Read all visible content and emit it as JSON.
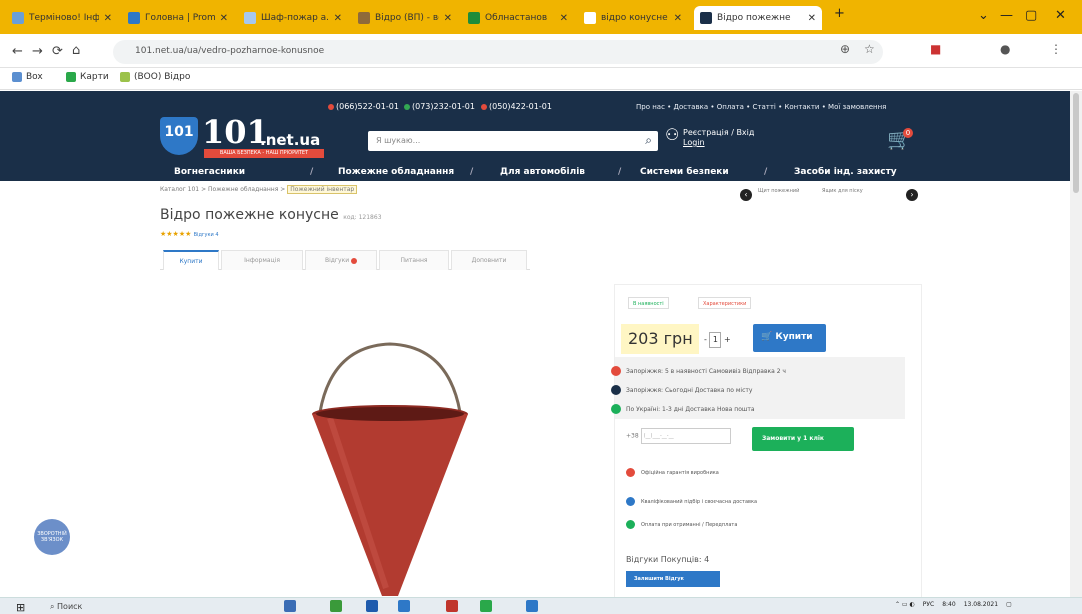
{
  "browser": {
    "tabs": [
      {
        "title": "Терміново! Інф",
        "color": "#6a9fd8"
      },
      {
        "title": "Головна | Prom",
        "color": "#2e78c7"
      },
      {
        "title": "Шаф-пожар а.р.",
        "color": "#a6c8ef"
      },
      {
        "title": "Відро (ВП) - всі",
        "color": "#8f6a3a"
      },
      {
        "title": "Облнастанов",
        "color": "#1f8c3a"
      },
      {
        "title": "відро конусне",
        "color": "#ffffff"
      },
      {
        "title": "Відро пожежне",
        "color": "#1a2f48",
        "active": true
      }
    ],
    "url": "101.net.ua/ua/vedro-pozharnoe-konusnoe",
    "bookmarks": [
      "Box",
      "Карти",
      "(ВОО) Відро"
    ]
  },
  "site": {
    "phones": [
      {
        "number": "(066)522-01-01",
        "color": "#e34b3c"
      },
      {
        "number": "(073)232-01-01",
        "color": "#33a853"
      },
      {
        "number": "(050)422-01-01",
        "color": "#e34b3c"
      }
    ],
    "top_links": "Про нас  •  Доставка  •  Оплата  •  Статті  •  Контакти  •  Мої замовлення",
    "logo": {
      "mark": "101",
      "number": "101",
      "domain": ".net.ua",
      "tagline": "ВАША БЕЗПЕКА - НАШ ПРІОРИТЕТ"
    },
    "search_placeholder": "Я шукаю...",
    "login": {
      "line1": "Реєстрація / Вхід",
      "line2": "Login"
    },
    "cart_count": "0",
    "nav": [
      "Вогнегасники",
      "Пожежне обладнання",
      "Для автомобілів",
      "Системи безпеки",
      "Засоби інд. захисту"
    ],
    "nav_separator": "/"
  },
  "breadcrumbs": {
    "home": "Каталог 101",
    "parent": "Пожежне обладнання",
    "current": "Пожежний інвентар",
    "separator": ">"
  },
  "prev_next": {
    "prev": "Щит пожежний",
    "next": "Ящик для піску"
  },
  "product": {
    "title": "Відро пожежне конусне",
    "code": "код: 121863",
    "stars": "★★★★★",
    "reviews_link": "Відгуки 4",
    "tabs": [
      "Купити",
      "Інформація",
      "Відгуки",
      "Питання",
      "Доповнити"
    ],
    "chips": [
      "В наявності",
      "Характеристики"
    ],
    "price": "203 грн",
    "qty": "1",
    "qty_minus": "-",
    "qty_plus": "+",
    "buy_label": "Купити",
    "stock": [
      {
        "text": "Запоріжжя: 5 в наявності  Самовивіз  Відправка 2 ч",
        "color": "#e34b3c"
      },
      {
        "text": "Запоріжжя: Сьогодні  Доставка по місту",
        "color": "#1a2f48"
      },
      {
        "text": "По Україні: 1-3 дні  Доставка Нова пошта",
        "color": "#1cb05a"
      }
    ],
    "phone_prefix": "+38",
    "phone_placeholder": "(__)___-__-__",
    "oneclick_label": "Замовити у 1 клік",
    "info": [
      {
        "text": "Офіційна гарантія виробника",
        "color": "#e34b3c"
      },
      {
        "text": "Кваліфікований підбір і своєчасна доставка",
        "color": "#2e78c7"
      },
      {
        "text": "Оплата при отриманні / Передплата",
        "color": "#1cb05a"
      }
    ],
    "reviews_heading": "Відгуки Покупців: 4",
    "review_button": "Залишити Відгук"
  },
  "widget": {
    "label": "ЗВОРОТНІЙ ЗВ'ЯЗОК"
  },
  "taskbar": {
    "search": "Поиск",
    "lang": "РУС",
    "time": "8:40",
    "date": "13.08.2021"
  }
}
